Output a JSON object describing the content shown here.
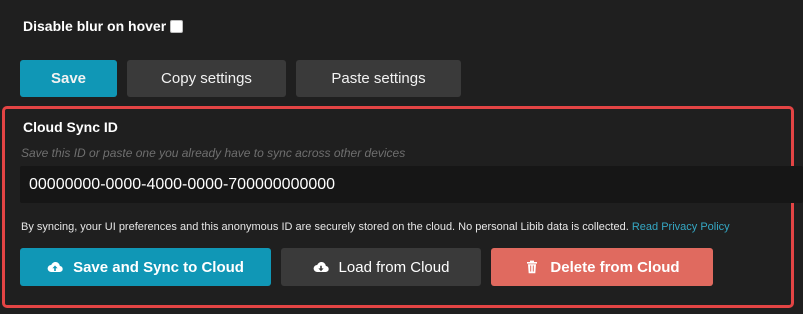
{
  "settings": {
    "disable_blur_label": "Disable blur on hover",
    "disable_blur_checked": false
  },
  "toolbar": {
    "save_label": "Save",
    "copy_label": "Copy settings",
    "paste_label": "Paste settings"
  },
  "cloud_sync": {
    "title": "Cloud Sync ID",
    "hint": "Save this ID or paste one you already have to sync across other devices",
    "sync_id_value": "00000000-0000-4000-0000-700000000000",
    "notice_text": "By syncing, your UI preferences and this anonymous ID are securely stored on the cloud. No personal Libib data is collected.",
    "privacy_link": "Read Privacy Policy",
    "save_sync_label": "Save and Sync to Cloud",
    "load_label": "Load from Cloud",
    "delete_label": "Delete from Cloud"
  },
  "icons": {
    "save_sync": "cloud-upload-icon",
    "load": "cloud-download-icon",
    "delete": "trash-icon"
  },
  "colors": {
    "primary": "#1097b6",
    "secondary": "#3a3a3a",
    "danger": "#e06a5f",
    "highlight_border": "#e34444",
    "link": "#35a7c3"
  }
}
